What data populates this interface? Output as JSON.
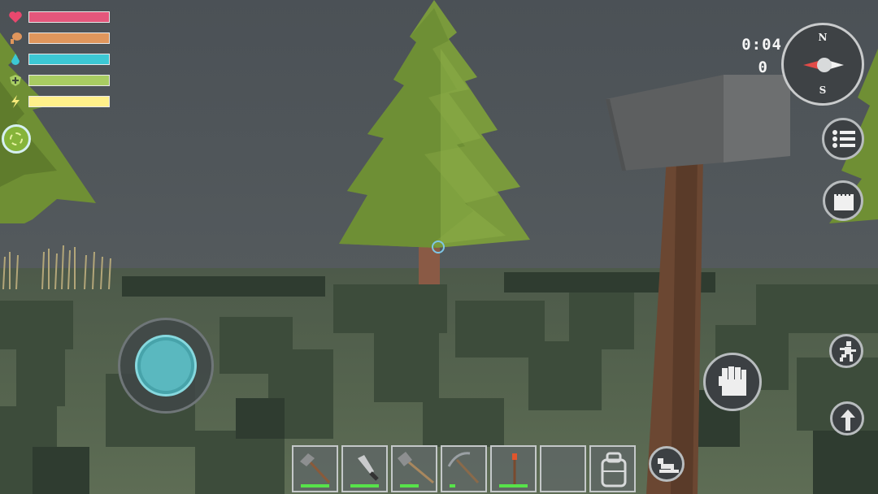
{
  "hud": {
    "stats": [
      {
        "name": "health",
        "icon": "heart-icon",
        "color": "#e4567b",
        "icon_color": "#e8486e",
        "level": 1.0
      },
      {
        "name": "hunger",
        "icon": "drumstick-icon",
        "color": "#e0965c",
        "icon_color": "#e0965c",
        "level": 1.0
      },
      {
        "name": "thirst",
        "icon": "water-drop-icon",
        "color": "#3cc8d4",
        "icon_color": "#3cc8d4",
        "level": 1.0
      },
      {
        "name": "armor",
        "icon": "shield-plus-icon",
        "color": "#a8cc62",
        "icon_color": "#a8cc62",
        "level": 1.0
      },
      {
        "name": "energy",
        "icon": "lightning-icon",
        "color": "#fff08a",
        "icon_color": "#f6ea7a",
        "level": 1.0
      }
    ],
    "status_effect_icon": "brain-icon"
  },
  "clock": {
    "time": "0:04",
    "day_count": "0"
  },
  "compass": {
    "north_label": "N",
    "south_label": "S"
  },
  "controls": {
    "menu_icon": "list-menu-icon",
    "crafting_icon": "clipboard-icon",
    "sprint_icon": "running-man-icon",
    "jump_icon": "up-arrow-icon",
    "attack_icon": "fist-icon",
    "crouch_icon": "crouch-icon",
    "joystick_icon": "joystick-icon"
  },
  "hotbar": {
    "slots": [
      {
        "item": "hammer-icon",
        "durability": 1.0
      },
      {
        "item": "knife-icon",
        "durability": 1.0
      },
      {
        "item": "axe-icon",
        "durability": 0.65
      },
      {
        "item": "pickaxe-icon",
        "durability": 0.2
      },
      {
        "item": "torch-icon",
        "durability": 1.0
      },
      {
        "item": "",
        "durability": null
      },
      {
        "item": "backpack-icon",
        "durability": null
      }
    ]
  },
  "held_item": "stone-hammer"
}
